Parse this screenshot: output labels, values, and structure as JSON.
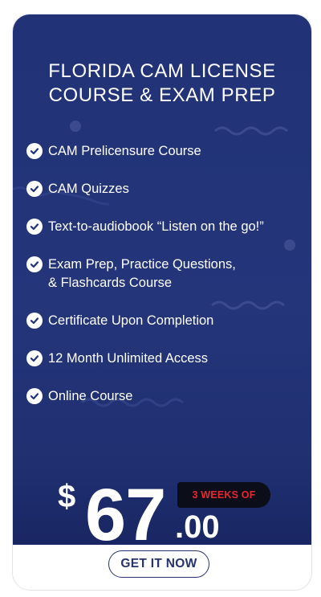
{
  "card": {
    "title_line1": "FLORIDA CAM LICENSE",
    "title_line2": "COURSE & EXAM PREP",
    "colors": {
      "background": "#213276",
      "badge_text": "#e8262d",
      "badge_bg": "#0b0e18",
      "button_text": "#26336f"
    }
  },
  "features": [
    {
      "icon": "check-circle-icon",
      "label": "CAM Prelicensure Course"
    },
    {
      "icon": "check-circle-icon",
      "label": "CAM Quizzes"
    },
    {
      "icon": "check-circle-icon",
      "label": "Text-to-audiobook “Listen on the go!”"
    },
    {
      "icon": "check-circle-icon",
      "label": "Exam Prep, Practice Questions,",
      "label2": "& Flashcards Course"
    },
    {
      "icon": "check-circle-icon",
      "label": "Certificate Upon Completion"
    },
    {
      "icon": "check-circle-icon",
      "label": "12 Month Unlimited Access"
    },
    {
      "icon": "check-circle-icon",
      "label": "Online Course"
    }
  ],
  "price": {
    "currency": "$",
    "whole": "67",
    "cents": ".00",
    "badge": "3 WEEKS OF"
  },
  "cta": {
    "label": "GET IT NOW"
  }
}
